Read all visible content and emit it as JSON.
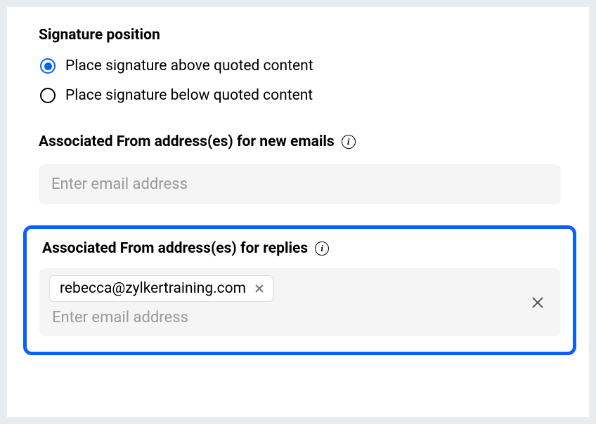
{
  "signaturePosition": {
    "title": "Signature position",
    "options": [
      {
        "label": "Place signature above quoted content",
        "selected": true
      },
      {
        "label": "Place signature below quoted content",
        "selected": false
      }
    ]
  },
  "newEmails": {
    "title": "Associated From address(es) for new emails",
    "placeholder": "Enter email address"
  },
  "replies": {
    "title": "Associated From address(es) for replies",
    "tags": [
      {
        "email": "rebecca@zylkertraining.com"
      }
    ],
    "placeholder": "Enter email address"
  },
  "icons": {
    "info": "i"
  }
}
